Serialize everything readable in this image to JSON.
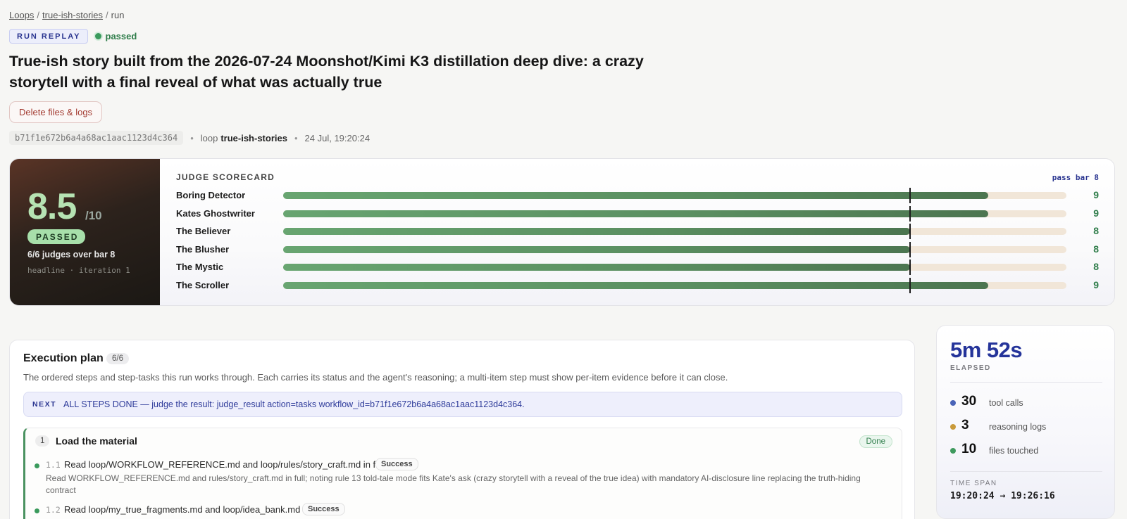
{
  "breadcrumb": {
    "root": "Loops",
    "loop": "true-ish-stories",
    "current": "run",
    "separator": "/"
  },
  "tags": {
    "replay": "RUN REPLAY",
    "status": "passed"
  },
  "title": "True-ish story built from the 2026-07-24 Moonshot/Kimi K3 distillation deep dive: a crazy storytell with a final reveal of what was actually true",
  "actions": {
    "delete": "Delete files & logs"
  },
  "meta": {
    "hash": "b71f1e672b6a4a68ac1aac1123d4c364",
    "loop_prefix": "loop",
    "loop_name": "true-ish-stories",
    "timestamp": "24 Jul, 19:20:24",
    "bullet": "•"
  },
  "hero": {
    "score": "8.5",
    "out_of": "/10",
    "badge": "PASSED",
    "summary": "6/6 judges over bar 8",
    "note": "headline · iteration 1"
  },
  "scorecard": {
    "heading": "JUDGE SCORECARD",
    "pass_bar_label": "pass bar 8",
    "max": 10,
    "pass_bar": 8,
    "judges": [
      {
        "name": "Boring Detector",
        "score": 9
      },
      {
        "name": "Kates Ghostwriter",
        "score": 9
      },
      {
        "name": "The Believer",
        "score": 8
      },
      {
        "name": "The Blusher",
        "score": 8
      },
      {
        "name": "The Mystic",
        "score": 8
      },
      {
        "name": "The Scroller",
        "score": 9
      }
    ]
  },
  "plan": {
    "title": "Execution plan",
    "count": "6/6",
    "description": "The ordered steps and step-tasks this run works through. Each carries its status and the agent's reasoning; a multi-item step must show per-item evidence before it can close.",
    "next_label": "NEXT",
    "next_text": "ALL STEPS DONE — judge the result: judge_result action=tasks workflow_id=b71f1e672b6a4a68ac1aac1123d4c364.",
    "step": {
      "number": "1",
      "title": "Load the material",
      "status": "Done",
      "tasks": [
        {
          "num": "1.1",
          "title": "Read loop/WORKFLOW_REFERENCE.md and loop/rules/story_craft.md in full",
          "badge": "Success",
          "note": "Read WORKFLOW_REFERENCE.md and rules/story_craft.md in full; noting rule 13 told-tale mode fits Kate's ask (crazy storytell with a reveal of the true idea) with mandatory AI-disclosure line replacing the truth-hiding contract"
        },
        {
          "num": "1.2",
          "title": "Read loop/my_true_fragments.md and loop/idea_bank.md",
          "badge": "Success",
          "note": ""
        }
      ]
    }
  },
  "stats": {
    "elapsed": "5m 52s",
    "elapsed_label": "ELAPSED",
    "items": [
      {
        "value": "30",
        "label": "tool calls",
        "color": "#4a64b8"
      },
      {
        "value": "3",
        "label": "reasoning logs",
        "color": "#c99a3a"
      },
      {
        "value": "10",
        "label": "files touched",
        "color": "#3f9a5e"
      }
    ],
    "span_label": "TIME SPAN",
    "span": "19:20:24 → 19:26:16"
  }
}
